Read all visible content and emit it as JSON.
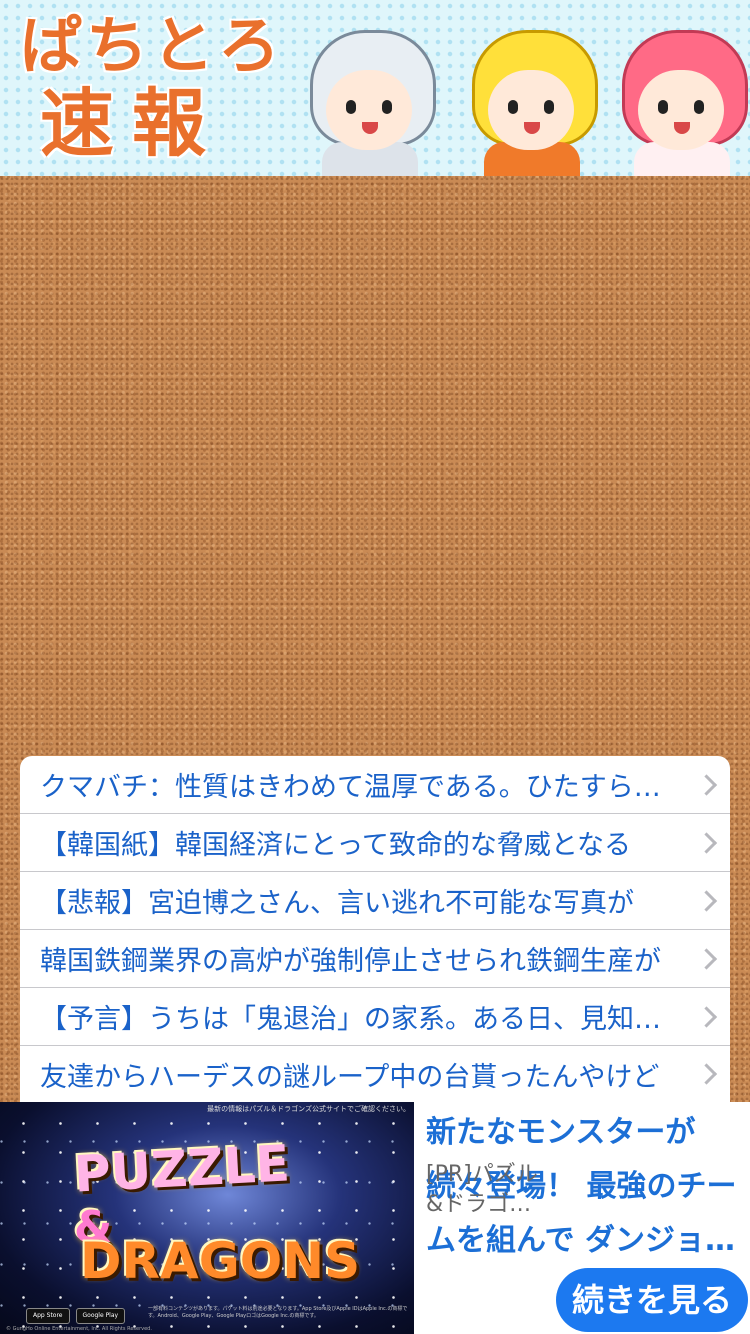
{
  "header": {
    "logo_line1": "ぱちとろ",
    "logo_line2": "速報"
  },
  "articles": [
    {
      "title": "クマバチ：性質はきわめて温厚である。ひたすら花を求めて飛び回り"
    },
    {
      "title": "【韓国紙】韓国経済にとって致命的な脅威となる"
    },
    {
      "title": "【悲報】宮迫博之さん、言い逃れ不可能な写真が"
    },
    {
      "title": "韓国鉄鋼業界の高炉が強制停止させられ鉄鋼生産が"
    },
    {
      "title": "【予言】うちは「鬼退治」の家系。ある日、見知らぬ"
    },
    {
      "title": "友達からハーデスの謎ループ中の台貰ったんやけど"
    }
  ],
  "ad": {
    "image_topnote": "最新の情報はパズル＆ドラゴンズ公式サイトでご確認ください。",
    "logo_puzzle": "PUZZLE",
    "logo_amp": "&",
    "logo_dragons": "DRAGONS",
    "badge_appstore": "App Store",
    "badge_googleplay": "Google Play",
    "legal": "一部有料コンテンツがあります。パケット料は別途必要となります。App Store及びApple IDはApple Inc.の商標です。Android、Google Play、Google PlayロゴはGoogle Inc.の商標です。",
    "copyright": "© GungHo Online Entertainment, Inc. All Rights Reserved.",
    "headline": "新たなモンスターが続々登場！ 最強のチームを組んで ダンジョンに挑もう",
    "sponsor": "[PR]パズル&ドラゴ…",
    "cta": "続きを見る"
  }
}
